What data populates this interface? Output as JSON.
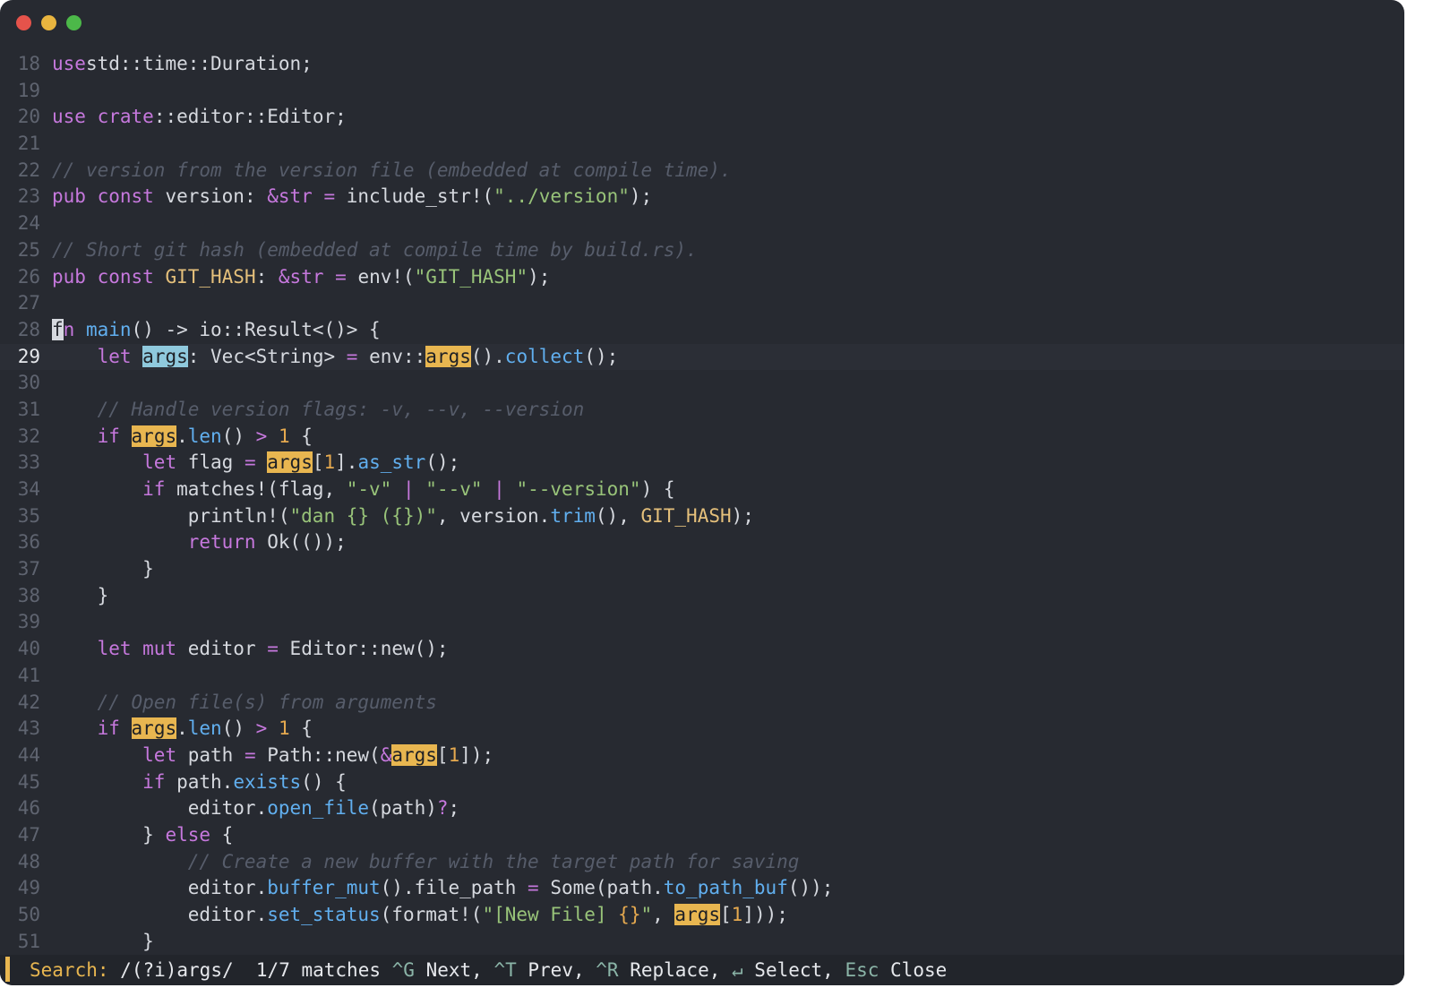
{
  "window": {
    "traffic_lights": [
      {
        "name": "close",
        "color": "#e5534b"
      },
      {
        "name": "minimize",
        "color": "#e9b53f"
      },
      {
        "name": "maximize",
        "color": "#4cb849"
      }
    ]
  },
  "editor": {
    "current_line": 29,
    "lines": [
      {
        "n": "18",
        "segs": [
          [
            "kw",
            "use"
          ],
          [
            "",
            "std::time::Duration;"
          ]
        ]
      },
      {
        "n": "19",
        "segs": []
      },
      {
        "n": "20",
        "segs": [
          [
            "kw",
            "use"
          ],
          [
            "",
            ""
          ],
          [
            "kw",
            "crate"
          ],
          [
            "",
            "::editor::Editor;"
          ]
        ]
      },
      {
        "n": "21",
        "segs": []
      },
      {
        "n": "22",
        "segs": [
          [
            "cm",
            "// version from the version file (embedded at compile time)."
          ]
        ]
      },
      {
        "n": "23",
        "segs": [
          [
            "kw",
            "pub const"
          ],
          [
            "",
            " version: "
          ],
          [
            "kw",
            "&str"
          ],
          [
            "",
            " "
          ],
          [
            "op",
            "="
          ],
          [
            "",
            " include_str!("
          ],
          [
            "str",
            "\"../version\""
          ],
          [
            "",
            ");"
          ]
        ]
      },
      {
        "n": "24",
        "segs": []
      },
      {
        "n": "25",
        "segs": [
          [
            "cm",
            "// Short git hash (embedded at compile time by build.rs)."
          ]
        ]
      },
      {
        "n": "26",
        "segs": [
          [
            "kw",
            "pub const"
          ],
          [
            "",
            " "
          ],
          [
            "const",
            "GIT_HASH"
          ],
          [
            "",
            ": "
          ],
          [
            "kw",
            "&str"
          ],
          [
            "",
            " "
          ],
          [
            "op",
            "="
          ],
          [
            "",
            " env!("
          ],
          [
            "str",
            "\"GIT_HASH\""
          ],
          [
            "",
            ");"
          ]
        ]
      },
      {
        "n": "27",
        "segs": []
      },
      {
        "n": "28",
        "segs": [
          [
            "cursor",
            "f"
          ],
          [
            "kw",
            "n"
          ],
          [
            "",
            " "
          ],
          [
            "fn",
            "main"
          ],
          [
            "",
            "() -> io::Result<()> {"
          ]
        ]
      },
      {
        "n": "29",
        "segs": [
          [
            "",
            "    "
          ],
          [
            "kw",
            "let"
          ],
          [
            "",
            " "
          ],
          [
            "hl-cur",
            "args"
          ],
          [
            "",
            ": Vec<String> "
          ],
          [
            "op",
            "="
          ],
          [
            "",
            " env::"
          ],
          [
            "hl",
            "args"
          ],
          [
            "",
            "()."
          ],
          [
            "fn",
            "collect"
          ],
          [
            "",
            "();"
          ]
        ]
      },
      {
        "n": "30",
        "segs": []
      },
      {
        "n": "31",
        "segs": [
          [
            "",
            "    "
          ],
          [
            "cm",
            "// Handle version flags: -v, --v, --version"
          ]
        ]
      },
      {
        "n": "32",
        "segs": [
          [
            "",
            "    "
          ],
          [
            "kw",
            "if"
          ],
          [
            "",
            " "
          ],
          [
            "hl",
            "args"
          ],
          [
            "",
            "."
          ],
          [
            "fn",
            "len"
          ],
          [
            "",
            "() "
          ],
          [
            "op",
            ">"
          ],
          [
            "",
            " "
          ],
          [
            "num",
            "1"
          ],
          [
            "",
            " {"
          ]
        ]
      },
      {
        "n": "33",
        "segs": [
          [
            "",
            "        "
          ],
          [
            "kw",
            "let"
          ],
          [
            "",
            " flag "
          ],
          [
            "op",
            "="
          ],
          [
            "",
            " "
          ],
          [
            "hl",
            "args"
          ],
          [
            "",
            "["
          ],
          [
            "num",
            "1"
          ],
          [
            "",
            "]."
          ],
          [
            "fn",
            "as_str"
          ],
          [
            "",
            "();"
          ]
        ]
      },
      {
        "n": "34",
        "segs": [
          [
            "",
            "        "
          ],
          [
            "kw",
            "if"
          ],
          [
            "",
            " matches!(flag, "
          ],
          [
            "str",
            "\"-v\""
          ],
          [
            "",
            " "
          ],
          [
            "op",
            "|"
          ],
          [
            "",
            " "
          ],
          [
            "str",
            "\"--v\""
          ],
          [
            "",
            " "
          ],
          [
            "op",
            "|"
          ],
          [
            "",
            " "
          ],
          [
            "str",
            "\"--version\""
          ],
          [
            "",
            ") {"
          ]
        ]
      },
      {
        "n": "35",
        "segs": [
          [
            "",
            "            println!("
          ],
          [
            "str",
            "\"dan {} ({})\""
          ],
          [
            "",
            ", version."
          ],
          [
            "fn",
            "trim"
          ],
          [
            "",
            "(), "
          ],
          [
            "const",
            "GIT_HASH"
          ],
          [
            "",
            ");"
          ]
        ]
      },
      {
        "n": "36",
        "segs": [
          [
            "",
            "            "
          ],
          [
            "kw",
            "return"
          ],
          [
            "",
            " Ok(());"
          ]
        ]
      },
      {
        "n": "37",
        "segs": [
          [
            "",
            "        }"
          ]
        ]
      },
      {
        "n": "38",
        "segs": [
          [
            "",
            "    }"
          ]
        ]
      },
      {
        "n": "39",
        "segs": []
      },
      {
        "n": "40",
        "segs": [
          [
            "",
            "    "
          ],
          [
            "kw",
            "let mut"
          ],
          [
            "",
            " editor "
          ],
          [
            "op",
            "="
          ],
          [
            "",
            " Editor::new();"
          ]
        ]
      },
      {
        "n": "41",
        "segs": []
      },
      {
        "n": "42",
        "segs": [
          [
            "",
            "    "
          ],
          [
            "cm",
            "// Open file(s) from arguments"
          ]
        ]
      },
      {
        "n": "43",
        "segs": [
          [
            "",
            "    "
          ],
          [
            "kw",
            "if"
          ],
          [
            "",
            " "
          ],
          [
            "hl",
            "args"
          ],
          [
            "",
            "."
          ],
          [
            "fn",
            "len"
          ],
          [
            "",
            "() "
          ],
          [
            "op",
            ">"
          ],
          [
            "",
            " "
          ],
          [
            "num",
            "1"
          ],
          [
            "",
            " {"
          ]
        ]
      },
      {
        "n": "44",
        "segs": [
          [
            "",
            "        "
          ],
          [
            "kw",
            "let"
          ],
          [
            "",
            " path "
          ],
          [
            "op",
            "="
          ],
          [
            "",
            " Path::new("
          ],
          [
            "op",
            "&"
          ],
          [
            "hl",
            "args"
          ],
          [
            "",
            "["
          ],
          [
            "num",
            "1"
          ],
          [
            "",
            "]);"
          ]
        ]
      },
      {
        "n": "45",
        "segs": [
          [
            "",
            "        "
          ],
          [
            "kw",
            "if"
          ],
          [
            "",
            " path."
          ],
          [
            "fn",
            "exists"
          ],
          [
            "",
            "() {"
          ]
        ]
      },
      {
        "n": "46",
        "segs": [
          [
            "",
            "            editor."
          ],
          [
            "fn",
            "open_file"
          ],
          [
            "",
            "(path)"
          ],
          [
            "op",
            "?"
          ],
          [
            "",
            ";"
          ]
        ]
      },
      {
        "n": "47",
        "segs": [
          [
            "",
            "        } "
          ],
          [
            "kw",
            "else"
          ],
          [
            "",
            " {"
          ]
        ]
      },
      {
        "n": "48",
        "segs": [
          [
            "",
            "            "
          ],
          [
            "cm",
            "// Create a new buffer with the target path for saving"
          ]
        ]
      },
      {
        "n": "49",
        "segs": [
          [
            "",
            "            editor."
          ],
          [
            "fn",
            "buffer_mut"
          ],
          [
            "",
            "().file_path "
          ],
          [
            "op",
            "="
          ],
          [
            "",
            " Some(path."
          ],
          [
            "fn",
            "to_path_buf"
          ],
          [
            "",
            "());"
          ]
        ]
      },
      {
        "n": "50",
        "segs": [
          [
            "",
            "            editor."
          ],
          [
            "fn",
            "set_status"
          ],
          [
            "",
            "(format!("
          ],
          [
            "str",
            "\"[New File] "
          ],
          [
            "num",
            "{}"
          ],
          [
            "str",
            "\""
          ],
          [
            "",
            ", "
          ],
          [
            "hl",
            "args"
          ],
          [
            "",
            "["
          ],
          [
            "num",
            "1"
          ],
          [
            "",
            "]));"
          ]
        ]
      },
      {
        "n": "51",
        "segs": [
          [
            "",
            "        }"
          ]
        ]
      }
    ]
  },
  "status": {
    "label": "Search:",
    "pattern": "/(?i)args/",
    "matches": "1/7 matches",
    "hints": [
      {
        "key": "^G",
        "action": "Next,"
      },
      {
        "key": "^T",
        "action": "Prev,"
      },
      {
        "key": "^R",
        "action": "Replace,"
      },
      {
        "key": "↵",
        "action": "Select,"
      },
      {
        "key": "Esc",
        "action": "Close"
      }
    ]
  }
}
